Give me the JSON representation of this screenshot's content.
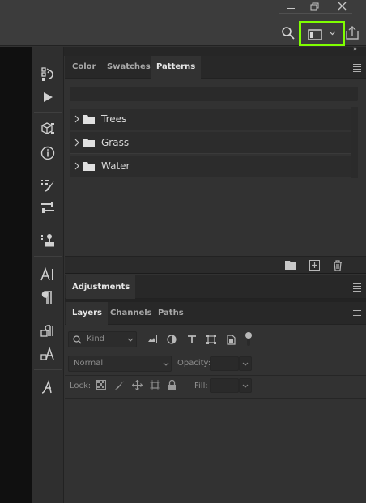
{
  "window": {
    "min_icon": "minimize-icon",
    "restore_icon": "restore-icon",
    "close_icon": "close-icon"
  },
  "options_bar": {
    "search_icon": "search-icon",
    "workspace_icon": "workspace-icon",
    "share_icon": "share-icon",
    "highlight_color": "#7fff00"
  },
  "tools": [
    {
      "name": "history-icon"
    },
    {
      "name": "play-icon"
    },
    {
      "name": "3d-icon"
    },
    {
      "name": "info-icon"
    },
    {
      "name": "brush-settings-icon"
    },
    {
      "name": "adjust-icon"
    },
    {
      "name": "clone-stamp-icon"
    },
    {
      "name": "character-icon"
    },
    {
      "name": "paragraph-icon"
    },
    {
      "name": "paragraph-styles-icon"
    },
    {
      "name": "character-styles-icon"
    },
    {
      "name": "glyphs-icon"
    }
  ],
  "top_panel": {
    "tabs": [
      "Color",
      "Swatches",
      "Patterns"
    ],
    "active_tab": "Patterns",
    "groups": [
      {
        "label": "Trees"
      },
      {
        "label": "Grass"
      },
      {
        "label": "Water"
      }
    ]
  },
  "adjustments": {
    "tab": "Adjustments"
  },
  "layers": {
    "tabs": [
      "Layers",
      "Channels",
      "Paths"
    ],
    "active_tab": "Layers",
    "kind_label": "Kind",
    "blend_mode": "Normal",
    "opacity_label": "Opacity:",
    "lock_label": "Lock:",
    "fill_label": "Fill:"
  },
  "colors": {
    "panel_bg": "#323232",
    "tab_bg": "#282828",
    "canvas": "#101010",
    "text": "#c8c8c8"
  }
}
